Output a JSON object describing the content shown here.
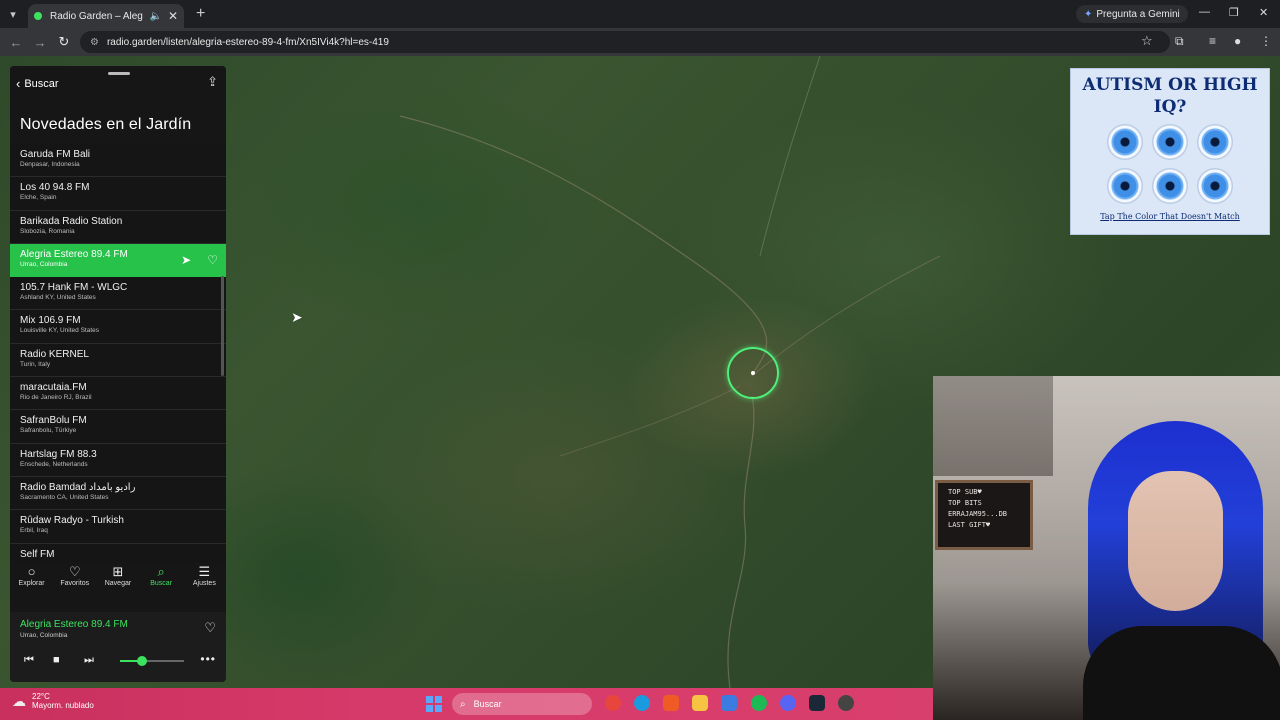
{
  "browser": {
    "tab_title": "Radio Garden – Alegria Este",
    "url": "radio.garden/listen/alegria-estereo-89-4-fm/Xn5IVi4k?hl=es-419",
    "gemini_label": "Pregunta a Gemini"
  },
  "panel": {
    "back_label": "Buscar",
    "title": "Novedades en el Jardín",
    "stations": [
      {
        "name": "Garuda FM Bali",
        "location": "Denpasar, Indonesia"
      },
      {
        "name": "Los 40 94.8 FM",
        "location": "Elche, Spain"
      },
      {
        "name": "Barikada Radio Station",
        "location": "Slobozia, Romania"
      },
      {
        "name": "Alegria Estereo 89.4 FM",
        "location": "Urrao, Colombia"
      },
      {
        "name": "105.7 Hank FM - WLGC",
        "location": "Ashland KY, United States"
      },
      {
        "name": "Mix 106.9 FM",
        "location": "Louisville KY, United States"
      },
      {
        "name": "Radio KERNEL",
        "location": "Turin, Italy"
      },
      {
        "name": "maracutaia.FM",
        "location": "Rio de Janeiro RJ, Brazil"
      },
      {
        "name": "SafranBolu FM",
        "location": "Safranbolu, Türkiye"
      },
      {
        "name": "Hartslag FM 88.3",
        "location": "Enschede, Netherlands"
      },
      {
        "name": "Radio Bamdad رادیو بامداد",
        "location": "Sacramento CA, United States"
      },
      {
        "name": "Rûdaw Radyo - Turkish",
        "location": "Erbil, Iraq"
      },
      {
        "name": "Self FM",
        "location": ""
      }
    ],
    "nav": [
      {
        "label": "Explorar",
        "icon": "circle-icon"
      },
      {
        "label": "Favoritos",
        "icon": "heart-icon"
      },
      {
        "label": "Navegar",
        "icon": "map-icon"
      },
      {
        "label": "Buscar",
        "icon": "search-icon"
      },
      {
        "label": "Ajustes",
        "icon": "menu-icon"
      }
    ],
    "player": {
      "station": "Alegria Estereo 89.4 FM",
      "location": "Urrao, Colombia",
      "volume": 0.35
    }
  },
  "ad": {
    "title": "AUTISM OR HIGH IQ?",
    "cta": "Tap The Color That Doesn't Match"
  },
  "webcam": {
    "board_lines": [
      "TOP SUB♥",
      "TOP BITS",
      "ERRAJAM95...DB",
      "LAST GIFT♥"
    ]
  },
  "taskbar": {
    "temperature": "22°C",
    "weather": "Mayorm. nublado",
    "search_placeholder": "Buscar"
  },
  "colors": {
    "accent": "#27c24a",
    "taskbar": "#d63a6a"
  }
}
